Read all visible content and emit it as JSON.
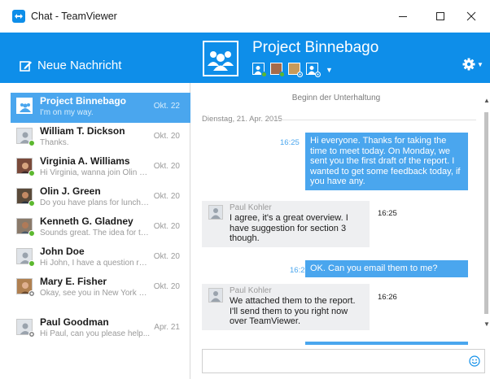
{
  "window": {
    "title": "Chat - TeamViewer",
    "controls": {
      "minimize": "minimize-icon",
      "maximize": "maximize-icon",
      "close": "close-icon"
    }
  },
  "sidebar": {
    "new_message_label": "Neue Nachricht",
    "contacts": [
      {
        "name": "Project Binnebago",
        "preview": "I'm on my way.",
        "date": "Okt. 22",
        "selected": true,
        "status": "group"
      },
      {
        "name": "William T. Dickson",
        "preview": "Thanks.",
        "date": "Okt. 20",
        "selected": false,
        "status": "online"
      },
      {
        "name": "Virginia A. Williams",
        "preview": "Hi Virginia, wanna join Olin an...",
        "date": "Okt. 20",
        "selected": false,
        "status": "online"
      },
      {
        "name": "Olin J. Green",
        "preview": "Do you have plans for lunch?...",
        "date": "Okt. 20",
        "selected": false,
        "status": "online"
      },
      {
        "name": "Kenneth G. Gladney",
        "preview": "Sounds great. The idea for the...",
        "date": "Okt. 20",
        "selected": false,
        "status": "online"
      },
      {
        "name": "John Doe",
        "preview": "Hi John, I have a question reg...",
        "date": "Okt. 20",
        "selected": false,
        "status": "online"
      },
      {
        "name": "Mary E. Fisher",
        "preview": "Okay, see you in New York ne...",
        "date": "Okt. 20",
        "selected": false,
        "status": "offline"
      },
      {
        "name": "Paul Goodman",
        "preview": "Hi Paul, can you please help...",
        "date": "Apr. 21",
        "selected": false,
        "status": "offline"
      }
    ]
  },
  "conversation": {
    "title": "Project Binnebago",
    "participants": [
      "online",
      "online",
      "offline",
      "offline"
    ],
    "start_label": "Beginn der Unterhaltung",
    "day_label": "Dienstag, 21. Apr. 2015",
    "messages": [
      {
        "direction": "out",
        "time": "16:25",
        "text": "Hi everyone. Thanks for taking the time to meet today. On Monday, we sent you the first draft of the report. I wanted to get some feedback today, if you have any."
      },
      {
        "direction": "in",
        "sender": "Paul Kohler",
        "time": "16:25",
        "text": "I agree, it's a great overview. I have suggestion for section 3 though."
      },
      {
        "direction": "out",
        "time": "16:26",
        "text": "OK. Can you email them to me?"
      },
      {
        "direction": "in",
        "sender": "Paul Kohler",
        "time": "16:26",
        "text": "We attached them to the report. I'll send them to you right now over TeamViewer."
      }
    ],
    "input_value": "",
    "input_placeholder": ""
  },
  "colors": {
    "accent": "#0e8ee9",
    "bubble_out": "#4aa6ee",
    "bubble_in": "#eeeff1",
    "online": "#5cb82f"
  },
  "icons": {
    "app": "teamviewer-icon",
    "new_message": "compose-icon",
    "settings": "gear-icon",
    "emoji": "smiley-icon"
  }
}
